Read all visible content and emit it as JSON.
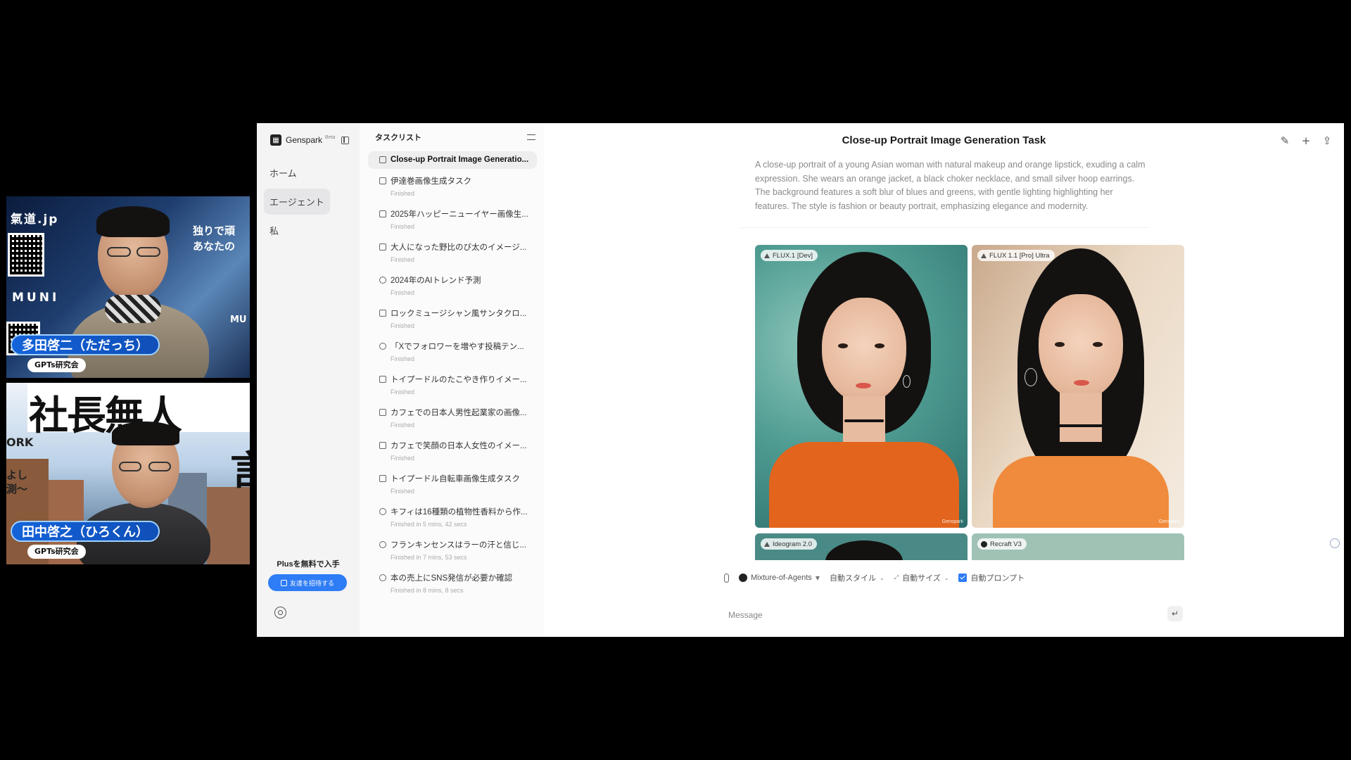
{
  "participants": [
    {
      "name": "多田啓二（ただっち）",
      "org": "GPTs研究会",
      "background_text": [
        "氣道.jp",
        "独りで頑",
        "あなたの",
        "MUNI",
        "MU"
      ]
    },
    {
      "name": "田中啓之（ひろくん）",
      "org": "GPTs研究会",
      "background_text": [
        "社長無人",
        "ORK",
        "よし",
        "測〜",
        "言"
      ]
    }
  ],
  "app": {
    "brand": "Genspark",
    "beta": "Beta",
    "nav": [
      {
        "label": "ホーム",
        "active": false
      },
      {
        "label": "エージェント",
        "active": true
      },
      {
        "label": "私",
        "active": false
      }
    ],
    "plus_text": "Plusを無料で入手",
    "invite_label": "友達を招待する"
  },
  "tasklist": {
    "title": "タスクリスト",
    "items": [
      {
        "title": "Close-up Portrait Image Generatio...",
        "status": "",
        "active": true,
        "icon": "image-task-icon"
      },
      {
        "title": "伊達巻画像生成タスク",
        "status": "Finished",
        "icon": "image-task-icon"
      },
      {
        "title": "2025年ハッピーニューイヤー画像生...",
        "status": "Finished",
        "icon": "image-task-icon"
      },
      {
        "title": "大人になった野比のび太のイメージ...",
        "status": "Finished",
        "icon": "image-task-icon"
      },
      {
        "title": "2024年のAIトレンド予測",
        "status": "Finished",
        "icon": "search-task-icon"
      },
      {
        "title": "ロックミュージシャン風サンタクロ...",
        "status": "Finished",
        "icon": "image-task-icon"
      },
      {
        "title": "「Xでフォロワーを増やす投稿テン...",
        "status": "Finished",
        "icon": "search-task-icon"
      },
      {
        "title": "トイプードルのたこやき作りイメー...",
        "status": "Finished",
        "icon": "image-task-icon"
      },
      {
        "title": "カフェでの日本人男性起業家の画像...",
        "status": "Finished",
        "icon": "image-task-icon"
      },
      {
        "title": "カフェで笑顔の日本人女性のイメー...",
        "status": "Finished",
        "icon": "image-task-icon"
      },
      {
        "title": "トイプードル自転車画像生成タスク",
        "status": "Finished",
        "icon": "image-task-icon"
      },
      {
        "title": "キフィは16種類の植物性香料から作...",
        "status": "Finished in 5 mins, 42 secs",
        "icon": "call-task-icon"
      },
      {
        "title": "フランキンセンスはラーの汗と信じ...",
        "status": "Finished in 7 mins, 53 secs",
        "icon": "call-task-icon"
      },
      {
        "title": "本の売上にSNS発信が必要か確認",
        "status": "Finished in 8 mins, 8 secs",
        "icon": "call-task-icon"
      }
    ]
  },
  "main": {
    "title": "Close-up Portrait Image Generation Task",
    "prompt": "A close-up portrait of a young Asian woman with natural makeup and orange lipstick, exuding a calm expression. She wears an orange jacket, a black choker necklace, and small silver hoop earrings. The background features a soft blur of blues and greens, with gentle lighting highlighting her features. The style is fashion or beauty portrait, emphasizing elegance and modernity.",
    "images": [
      {
        "model": "FLUX.1 [Dev]",
        "watermark": "Genspark"
      },
      {
        "model": "FLUX 1.1 [Pro] Ultra",
        "watermark": "Genspark"
      },
      {
        "model": "Ideogram 2.0"
      },
      {
        "model": "Recraft V3"
      }
    ],
    "toolbar": {
      "agent": "Mixture-of-Agents",
      "style": "自動スタイル",
      "size": "自動サイズ",
      "auto_prompt": "自動プロンプト",
      "auto_prompt_checked": true
    },
    "message_placeholder": "Message"
  }
}
